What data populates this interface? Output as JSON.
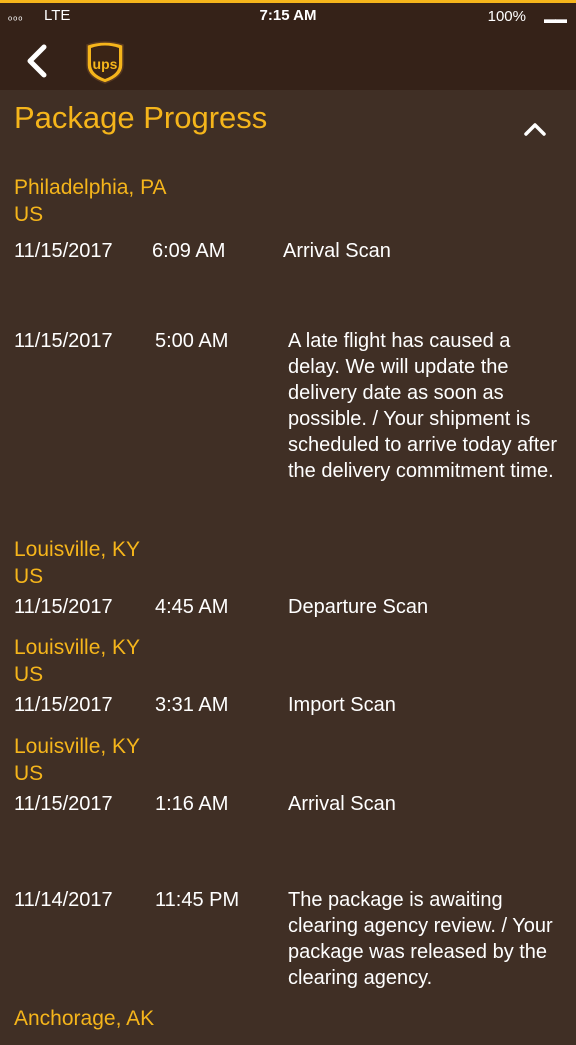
{
  "status_bar": {
    "signal": "ₒₒₒ",
    "carrier": "LTE",
    "time": "7:15 AM",
    "battery": "100%"
  },
  "nav": {
    "back_icon": "chevron-left-icon",
    "logo_text": "ups"
  },
  "header": {
    "title": "Package Progress",
    "collapse_icon": "chevron-up-icon"
  },
  "colors": {
    "accent": "#f5b51b",
    "background": "#402f25",
    "topbar": "#352218",
    "text": "#ffffff"
  },
  "events": [
    {
      "location_city": "Philadelphia, PA",
      "location_country": "US",
      "date": "11/15/2017",
      "time": "6:09 AM",
      "description": "Arrival Scan"
    },
    {
      "location_city": "",
      "location_country": "",
      "date": "11/15/2017",
      "time": "5:00 AM",
      "description": "A late flight has caused a delay. We will update the delivery date as soon as possible.  / Your shipment is scheduled to arrive today after the delivery commitment time."
    },
    {
      "location_city": "Louisville, KY",
      "location_country": "US",
      "date": "11/15/2017",
      "time": "4:45 AM",
      "description": "Departure Scan"
    },
    {
      "location_city": "Louisville, KY",
      "location_country": "US",
      "date": "11/15/2017",
      "time": "3:31 AM",
      "description": "Import Scan"
    },
    {
      "location_city": "Louisville, KY",
      "location_country": "US",
      "date": "11/15/2017",
      "time": "1:16 AM",
      "description": "Arrival Scan"
    },
    {
      "location_city": "",
      "location_country": "",
      "date": "11/14/2017",
      "time": "11:45 PM",
      "description": "The package is awaiting clearing agency review. / Your package was released by the clearing agency."
    },
    {
      "location_city": "Anchorage, AK",
      "location_country": "",
      "date": "",
      "time": "",
      "description": ""
    }
  ]
}
